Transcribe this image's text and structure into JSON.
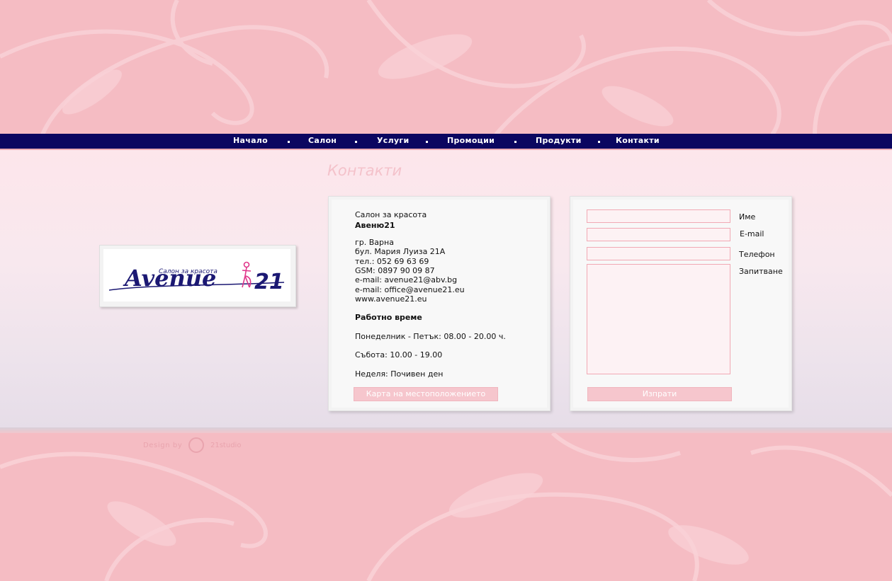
{
  "colors": {
    "nav_bg": "#0b0660",
    "accent_pink": "#f6c6cd",
    "page_bg": "#f5bcc3"
  },
  "nav": {
    "items": [
      {
        "label": "Начало"
      },
      {
        "label": "Салон"
      },
      {
        "label": "Услуги"
      },
      {
        "label": "Промоции"
      },
      {
        "label": "Продукти"
      },
      {
        "label": "Контакти"
      }
    ]
  },
  "page": {
    "title": "Контакти"
  },
  "logo": {
    "tagline": "Салон за красота",
    "brand": "Avenue",
    "number": "21"
  },
  "info": {
    "line1": "Салон за красота",
    "line2": "Авеню21",
    "city": "гр. Варна",
    "address": "бул. Мария Луиза 21А",
    "phone": "тел.: 052 69 63 69",
    "gsm": "GSM: 0897 90 09 87",
    "email1": "e-mail: avenue21@abv.bg",
    "email2": "e-mail: office@avenue21.eu",
    "website": "www.avenue21.eu",
    "hours_title": "Работно време",
    "weekdays": "Понеделник - Петък: 08.00 - 20.00 ч.",
    "saturday": "Събота: 10.00 - 19.00",
    "sunday": "Неделя: Почивен ден",
    "map_button": "Карта на местоположението"
  },
  "form": {
    "name_label": "Име",
    "email_label": "E-mail",
    "phone_label": "Телефон",
    "question_label": "Запитване",
    "name_value": "",
    "email_value": "",
    "phone_value": "",
    "question_value": "",
    "submit_label": "Изпрати"
  },
  "footer": {
    "design_by": "Design by",
    "studio": "21studio"
  }
}
